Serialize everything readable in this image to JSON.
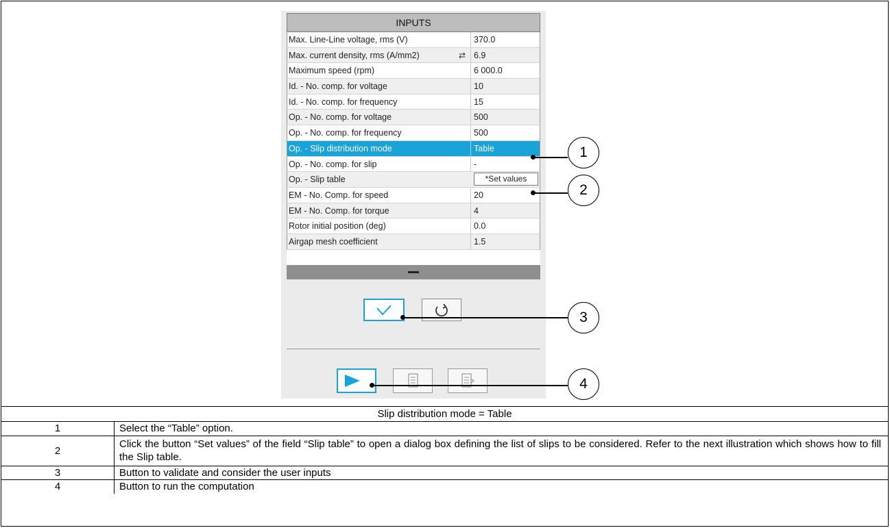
{
  "inputs": {
    "header": "INPUTS",
    "rows": [
      {
        "label": "Max. Line-Line voltage, rms (V)",
        "value": "370.0"
      },
      {
        "label": "Max. current density, rms (A/mm2)",
        "value": "6.9"
      },
      {
        "label": "Maximum speed (rpm)",
        "value": "6 000.0"
      },
      {
        "label": "Id. - No. comp. for voltage",
        "value": "10"
      },
      {
        "label": "Id. - No. comp. for frequency",
        "value": "15"
      },
      {
        "label": "Op. - No. comp. for voltage",
        "value": "500"
      },
      {
        "label": "Op. - No. comp. for frequency",
        "value": "500"
      },
      {
        "label": "Op. - Slip distribution mode",
        "value": "Table"
      },
      {
        "label": "Op. - No. comp. for slip",
        "value": "-"
      },
      {
        "label": "Op. - Slip table",
        "value": "*Set values"
      },
      {
        "label": "EM - No. Comp. for speed",
        "value": "20"
      },
      {
        "label": "EM - No. Comp. for torque",
        "value": "4"
      },
      {
        "label": "Rotor initial position (deg)",
        "value": "0.0"
      },
      {
        "label": "Airgap mesh coefficient",
        "value": "1.5"
      }
    ],
    "selected_row": 7,
    "swap_icon": "swap-arrows-icon"
  },
  "icons": {
    "validate": "check-icon",
    "reset": "reset-icon",
    "run": "play-icon",
    "doc1": "document-icon",
    "doc2": "document-export-icon"
  },
  "callouts": [
    "1",
    "2",
    "3",
    "4"
  ],
  "legend": {
    "title": "Slip distribution mode = Table",
    "rows": [
      {
        "num": "1",
        "text": "Select the “Table” option."
      },
      {
        "num": "2",
        "text": "Click the button “Set values” of the field “Slip table” to open a dialog box defining the list of slips to be considered. Refer to the next illustration which shows how to fill the Slip table."
      },
      {
        "num": "3",
        "text": "Button to validate and consider the user inputs"
      },
      {
        "num": "4",
        "text": "Button to run the computation"
      }
    ]
  },
  "colors": {
    "accent": "#1aa3d9",
    "header": "#bdbdbd",
    "panel": "#ebebeb"
  }
}
